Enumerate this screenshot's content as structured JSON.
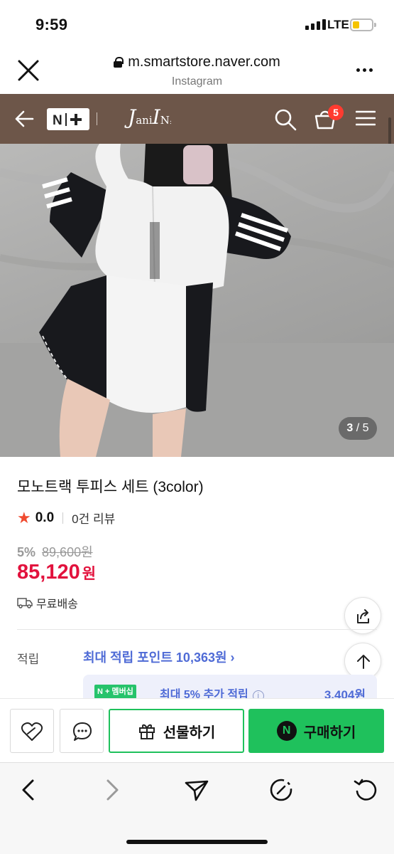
{
  "status": {
    "time": "9:59",
    "network": "LTE"
  },
  "browser": {
    "url": "m.smartstore.naver.com",
    "subtitle": "Instagram"
  },
  "store_header": {
    "badge": "N+",
    "brand": "JaniIN",
    "cart_count": "5"
  },
  "gallery": {
    "current": "3",
    "total": "/ 5"
  },
  "product": {
    "title": "모노트랙 투피스 세트 (3color)",
    "rating": "0.0",
    "reviews": "0건 리뷰",
    "discount": "5%",
    "original_price": "89,600원",
    "price": "85,120",
    "currency": "원",
    "shipping": "무료배송"
  },
  "points": {
    "label": "적립",
    "max": "최대 적립 포인트 10,363원 ›",
    "membership_badge": "N + 멤버십",
    "membership_text": "최대 5% 추가 적립",
    "membership_info": "i",
    "membership_value": "3,404원"
  },
  "actions": {
    "gift": "선물하기",
    "buy": "구매하기",
    "buy_icon": "N"
  },
  "icons": [
    "close-icon",
    "more-icon",
    "back-arrow-icon",
    "search-icon",
    "cart-icon",
    "menu-icon",
    "share-icon",
    "scroll-top-icon",
    "wishlist-icon",
    "chat-icon",
    "gift-icon",
    "browser-back-icon",
    "browser-forward-icon",
    "send-icon",
    "compass-icon",
    "reload-icon"
  ],
  "colors": {
    "store_header": "#6d5649",
    "price": "#e2123d",
    "naver_green": "#1fc15c",
    "point_blue": "#4f6bd6"
  }
}
